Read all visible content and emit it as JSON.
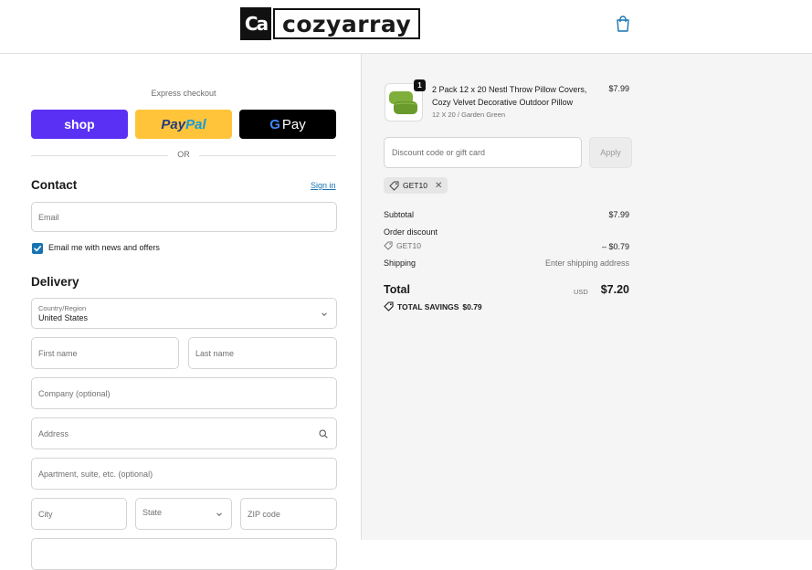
{
  "brand": {
    "logo_mark": "Ca",
    "logo_text": "cozyarray"
  },
  "express": {
    "label": "Express checkout",
    "shop_label": "shop",
    "paypal_a": "Pay",
    "paypal_b": "Pal",
    "gpay_g": "G",
    "gpay_label": "Pay",
    "or_label": "OR"
  },
  "contact": {
    "title": "Contact",
    "sign_in": "Sign in",
    "email_placeholder": "Email",
    "newsletter_label": "Email me with news and offers",
    "newsletter_checked": true
  },
  "delivery": {
    "title": "Delivery",
    "country_label": "Country/Region",
    "country_value": "United States",
    "first_name": "First name",
    "last_name": "Last name",
    "company": "Company (optional)",
    "address": "Address",
    "apartment": "Apartment, suite, etc. (optional)",
    "city": "City",
    "state": "State",
    "zip": "ZIP code"
  },
  "order": {
    "product": {
      "quantity": "1",
      "name": "2 Pack 12 x 20 Nestl Throw Pillow Covers, Cozy Velvet Decorative Outdoor Pillow",
      "variant": "12 X 20 / Garden Green",
      "price": "$7.99"
    },
    "discount_placeholder": "Discount code or gift card",
    "apply_label": "Apply",
    "applied_code": "GET10",
    "subtotal_label": "Subtotal",
    "subtotal_value": "$7.99",
    "order_discount_label": "Order discount",
    "discount_code": "GET10",
    "discount_value": "– $0.79",
    "shipping_label": "Shipping",
    "shipping_value": "Enter shipping address",
    "total_label": "Total",
    "currency": "USD",
    "total_value": "$7.20",
    "savings_label": "TOTAL SAVINGS",
    "savings_value": "$0.79"
  },
  "colors": {
    "shop": "#5a31f4",
    "paypal": "#ffc439",
    "gpay": "#000000",
    "link": "#1773b0",
    "summary_bg": "#f5f5f5"
  }
}
